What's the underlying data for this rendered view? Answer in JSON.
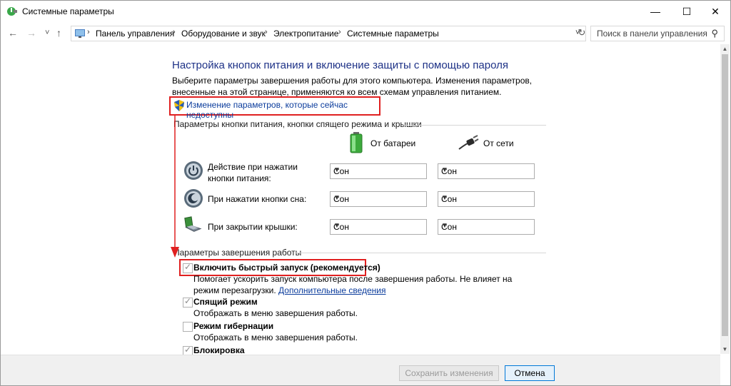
{
  "window": {
    "title": "Системные параметры",
    "controls": {
      "minimize": "—",
      "maximize": "☐",
      "close": "✕"
    }
  },
  "nav": {
    "back": "←",
    "forward": "→",
    "recent": "˅",
    "up": "↑",
    "breadcrumbs": [
      "Панель управления",
      "Оборудование и звук",
      "Электропитание",
      "Системные параметры"
    ],
    "breadcrumb_sep": "›",
    "dropdown": "˅",
    "refresh": "↻",
    "search_placeholder": "Поиск в панели управления",
    "search_icon": "⚲"
  },
  "main": {
    "heading": "Настройка кнопок питания и включение защиты с помощью пароля",
    "description": "Выберите параметры завершения работы для этого компьютера. Изменения параметров, внесенные на этой странице, применяются ко всем схемам управления питанием.",
    "change_link": "Изменение параметров, которые сейчас недоступны",
    "power_section": {
      "title": "Параметры кнопки питания, кнопки спящего режима и крышки",
      "col_battery": "От батареи",
      "col_ac": "От сети",
      "rows": [
        {
          "label": "Действие при нажатии кнопки питания:",
          "battery": "Сон",
          "ac": "Сон",
          "icon": "power-button-icon"
        },
        {
          "label": "При нажатии кнопки сна:",
          "battery": "Сон",
          "ac": "Сон",
          "icon": "sleep-button-icon"
        },
        {
          "label": "При закрытии крышки:",
          "battery": "Сон",
          "ac": "Сон",
          "icon": "laptop-lid-icon"
        }
      ]
    },
    "shutdown_section": {
      "title": "Параметры завершения работы",
      "items": [
        {
          "label": "Включить быстрый запуск (рекомендуется)",
          "checked": true,
          "desc": "Помогает ускорить запуск компьютера после завершения работы. Не влияет на режим перезагрузки.",
          "link": "Дополнительные сведения"
        },
        {
          "label": "Спящий режим",
          "checked": true,
          "desc": "Отображать в меню завершения работы."
        },
        {
          "label": "Режим гибернации",
          "checked": false,
          "desc": "Отображать в меню завершения работы."
        },
        {
          "label": "Блокировка",
          "checked": true
        }
      ]
    }
  },
  "footer": {
    "save": "Сохранить изменения",
    "cancel": "Отмена"
  },
  "colors": {
    "heading": "#1e3287",
    "link": "#0b3c9c",
    "highlight_border": "#e02020"
  }
}
